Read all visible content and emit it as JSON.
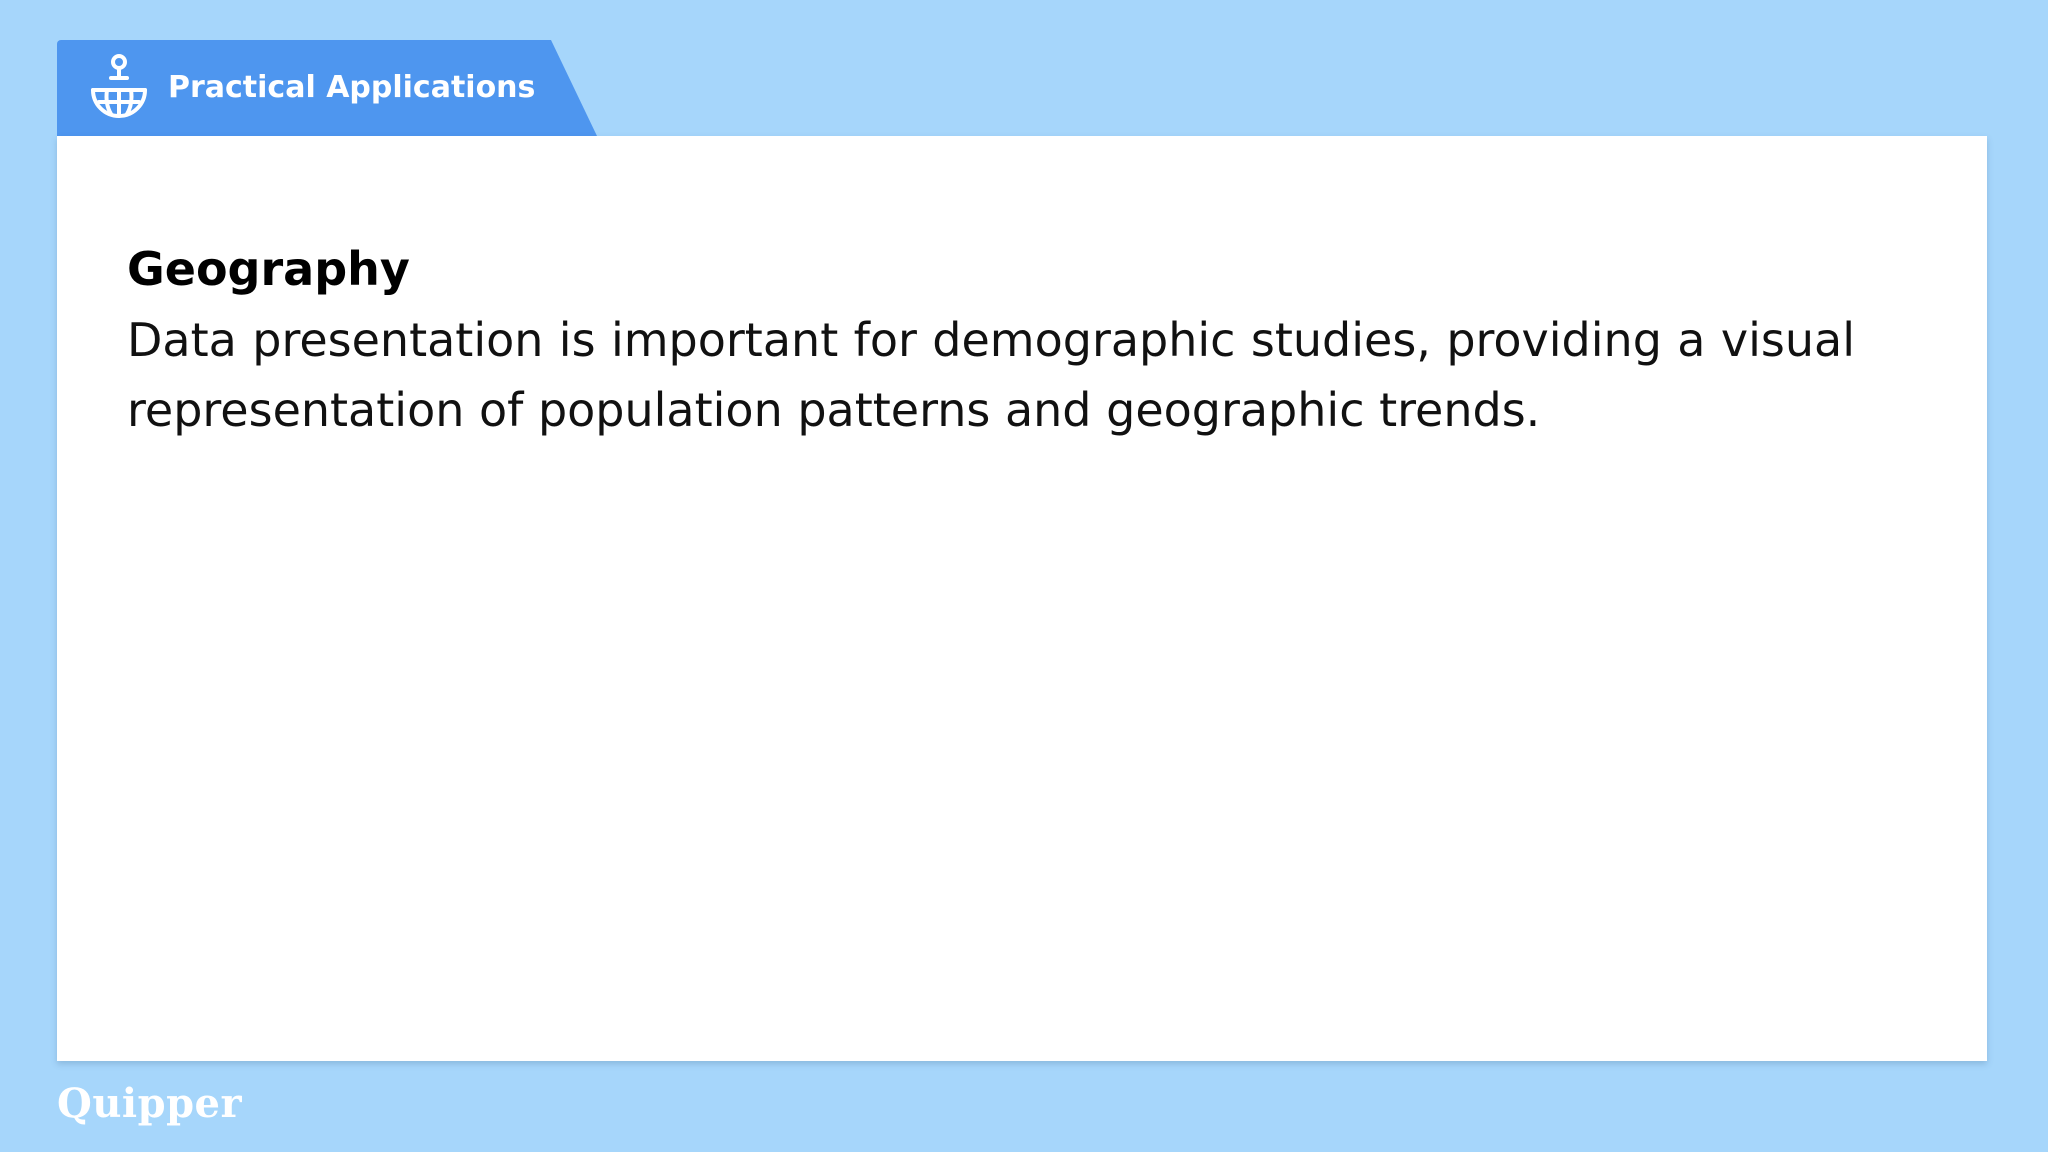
{
  "header": {
    "title": "Practical Applications",
    "icon": "globe-person-icon",
    "color": "#4e96ef"
  },
  "content": {
    "heading": "Geography",
    "body": "Data presentation is important for demographic studies, providing a visual representation of population patterns and geographic trends."
  },
  "footer": {
    "brand": "Quipper"
  },
  "colors": {
    "background": "#a6d6fb",
    "card": "#ffffff",
    "accent": "#4e96ef"
  }
}
